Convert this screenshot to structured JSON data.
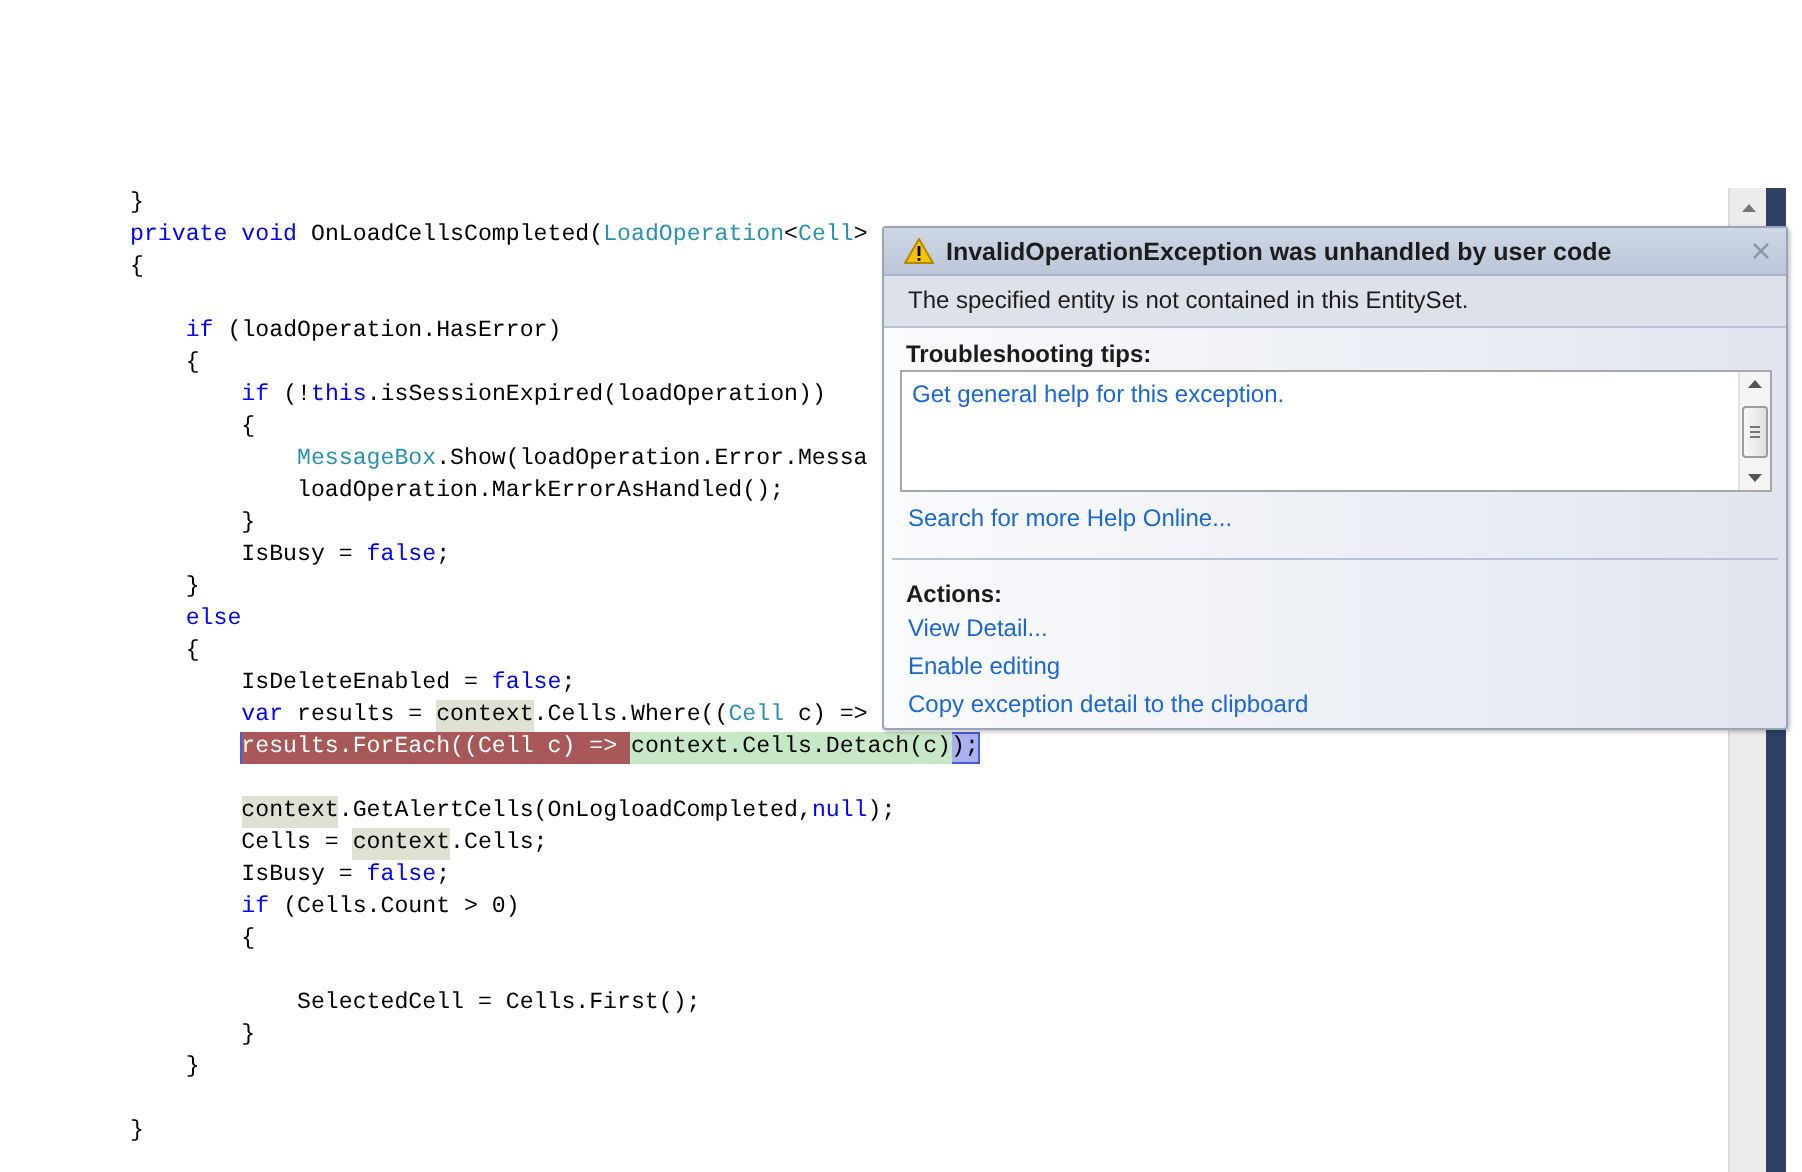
{
  "editor": {
    "lines": [
      {
        "kind": "code",
        "tokens": [
          {
            "text": "}",
            "kind": "plain"
          }
        ]
      },
      {
        "kind": "code",
        "tokens": [
          {
            "text": "private",
            "kind": "keyword"
          },
          {
            "text": " void",
            "kind": "keyword"
          },
          {
            "text": " OnLoadCellsCompleted(",
            "kind": "plain"
          },
          {
            "text": "LoadOperation",
            "kind": "type"
          },
          {
            "text": "<",
            "kind": "plain"
          },
          {
            "text": "Cell",
            "kind": "type"
          },
          {
            "text": ">",
            "kind": "plain"
          }
        ]
      },
      {
        "kind": "code",
        "tokens": [
          {
            "text": "{",
            "kind": "plain"
          }
        ]
      },
      {
        "kind": "blank"
      },
      {
        "kind": "code",
        "tokens": [
          {
            "text": "    if",
            "kind": "keyword"
          },
          {
            "text": " (loadOperation.HasError)",
            "kind": "plain"
          }
        ]
      },
      {
        "kind": "code",
        "tokens": [
          {
            "text": "    {",
            "kind": "plain"
          }
        ]
      },
      {
        "kind": "code",
        "tokens": [
          {
            "text": "        if",
            "kind": "keyword"
          },
          {
            "text": " (!",
            "kind": "plain"
          },
          {
            "text": "this",
            "kind": "keyword"
          },
          {
            "text": ".isSessionExpired(loadOperation))",
            "kind": "plain"
          }
        ]
      },
      {
        "kind": "code",
        "tokens": [
          {
            "text": "        {",
            "kind": "plain"
          }
        ]
      },
      {
        "kind": "code",
        "tokens": [
          {
            "text": "            MessageBox",
            "kind": "type"
          },
          {
            "text": ".Show(loadOperation.Error.Messa",
            "kind": "plain"
          }
        ]
      },
      {
        "kind": "code",
        "tokens": [
          {
            "text": "            loadOperation.MarkErrorAsHandled();",
            "kind": "plain"
          }
        ]
      },
      {
        "kind": "code",
        "tokens": [
          {
            "text": "        }",
            "kind": "plain"
          }
        ]
      },
      {
        "kind": "code",
        "tokens": [
          {
            "text": "        IsBusy = ",
            "kind": "plain"
          },
          {
            "text": "false",
            "kind": "keyword"
          },
          {
            "text": ";",
            "kind": "plain"
          }
        ]
      },
      {
        "kind": "code",
        "tokens": [
          {
            "text": "    }",
            "kind": "plain"
          }
        ]
      },
      {
        "kind": "code",
        "tokens": [
          {
            "text": "    else",
            "kind": "keyword"
          }
        ]
      },
      {
        "kind": "code",
        "tokens": [
          {
            "text": "    {",
            "kind": "plain"
          }
        ]
      },
      {
        "kind": "code",
        "tokens": [
          {
            "text": "        IsDeleteEnabled = ",
            "kind": "plain"
          },
          {
            "text": "false",
            "kind": "keyword"
          },
          {
            "text": ";",
            "kind": "plain"
          }
        ]
      },
      {
        "kind": "code",
        "tokens": [
          {
            "text": "        var",
            "kind": "keyword"
          },
          {
            "text": " results = ",
            "kind": "plain"
          },
          {
            "text": "context",
            "kind": "reference"
          },
          {
            "text": ".Cells.Where((",
            "kind": "plain"
          },
          {
            "text": "Cell",
            "kind": "type"
          },
          {
            "text": " c) =>",
            "kind": "plain"
          }
        ]
      },
      {
        "kind": "current",
        "tokens": [
          {
            "text": "        results.ForEach((Cell c) => ",
            "kind": "statement"
          },
          {
            "text": "context.Cells.Detach(c)",
            "kind": "expression"
          },
          {
            "text": ");",
            "kind": "plain"
          }
        ]
      },
      {
        "kind": "blank"
      },
      {
        "kind": "code",
        "tokens": [
          {
            "text": "        context",
            "kind": "reference"
          },
          {
            "text": ".GetAlertCells(OnLogloadCompleted,",
            "kind": "plain"
          },
          {
            "text": "null",
            "kind": "keyword"
          },
          {
            "text": ");",
            "kind": "plain"
          }
        ]
      },
      {
        "kind": "code",
        "tokens": [
          {
            "text": "        Cells = ",
            "kind": "plain"
          },
          {
            "text": "context",
            "kind": "reference"
          },
          {
            "text": ".Cells;",
            "kind": "plain"
          }
        ]
      },
      {
        "kind": "code",
        "tokens": [
          {
            "text": "        IsBusy = ",
            "kind": "plain"
          },
          {
            "text": "false",
            "kind": "keyword"
          },
          {
            "text": ";",
            "kind": "plain"
          }
        ]
      },
      {
        "kind": "code",
        "tokens": [
          {
            "text": "        if",
            "kind": "keyword"
          },
          {
            "text": " (Cells.Count > 0)",
            "kind": "plain"
          }
        ]
      },
      {
        "kind": "code",
        "tokens": [
          {
            "text": "        {",
            "kind": "plain"
          }
        ]
      },
      {
        "kind": "blank"
      },
      {
        "kind": "code",
        "tokens": [
          {
            "text": "            SelectedCell = Cells.First();",
            "kind": "plain"
          }
        ]
      },
      {
        "kind": "code",
        "tokens": [
          {
            "text": "        }",
            "kind": "plain"
          }
        ]
      },
      {
        "kind": "code",
        "tokens": [
          {
            "text": "    }",
            "kind": "plain"
          }
        ]
      },
      {
        "kind": "blank"
      },
      {
        "kind": "code",
        "tokens": [
          {
            "text": "}",
            "kind": "plain"
          }
        ]
      }
    ]
  },
  "exception_helper": {
    "title": "InvalidOperationException was unhandled by user code",
    "message": "The specified entity is not contained in this EntitySet.",
    "tips_heading": "Troubleshooting tips:",
    "tips": [
      "Get general help for this exception."
    ],
    "search_link": "Search for more Help Online...",
    "actions_heading": "Actions:",
    "actions": [
      "View Detail...",
      "Enable editing",
      "Copy exception detail to the clipboard"
    ]
  }
}
